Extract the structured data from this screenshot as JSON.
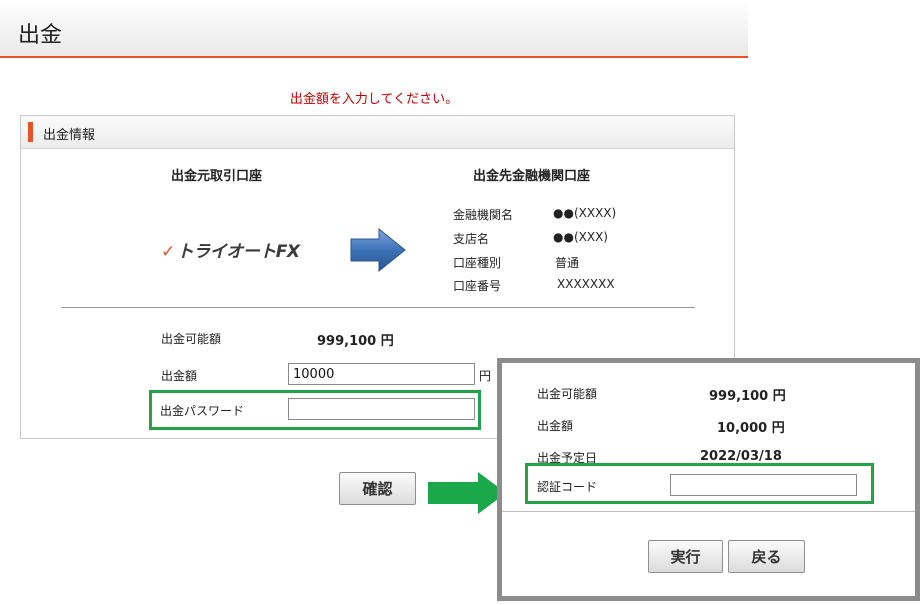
{
  "page": {
    "title": "出金"
  },
  "notice": "出金額を入力してください。",
  "panel": {
    "title": "出金情報",
    "source_title": "出金元取引口座",
    "dest_title": "出金先金融機関口座",
    "logo_text": "トライオートFX",
    "bank_info": [
      {
        "label": "金融機関名",
        "value": "●●(XXXX)"
      },
      {
        "label": "支店名",
        "value": "●●(XXX)"
      },
      {
        "label": "口座種別",
        "value": "普通"
      },
      {
        "label": "口座番号",
        "value": "XXXXXXX"
      }
    ],
    "available_label": "出金可能額",
    "available_value": "999,100 円",
    "amount_label": "出金額",
    "amount_value": "10000",
    "amount_unit": "円",
    "password_label": "出金パスワード",
    "password_value": ""
  },
  "confirm_button": "確認",
  "popup": {
    "available_label": "出金可能額",
    "available_value": "999,100 円",
    "amount_label": "出金額",
    "amount_value": "10,000 円",
    "date_label": "出金予定日",
    "date_value": "2022/03/18",
    "auth_label": "認証コード",
    "auth_value": "",
    "execute_button": "実行",
    "back_button": "戻る"
  },
  "colors": {
    "accent": "#e8522a",
    "highlight": "#22a34a",
    "notice": "#c00000",
    "arrow_blue": "#3d72b8"
  }
}
